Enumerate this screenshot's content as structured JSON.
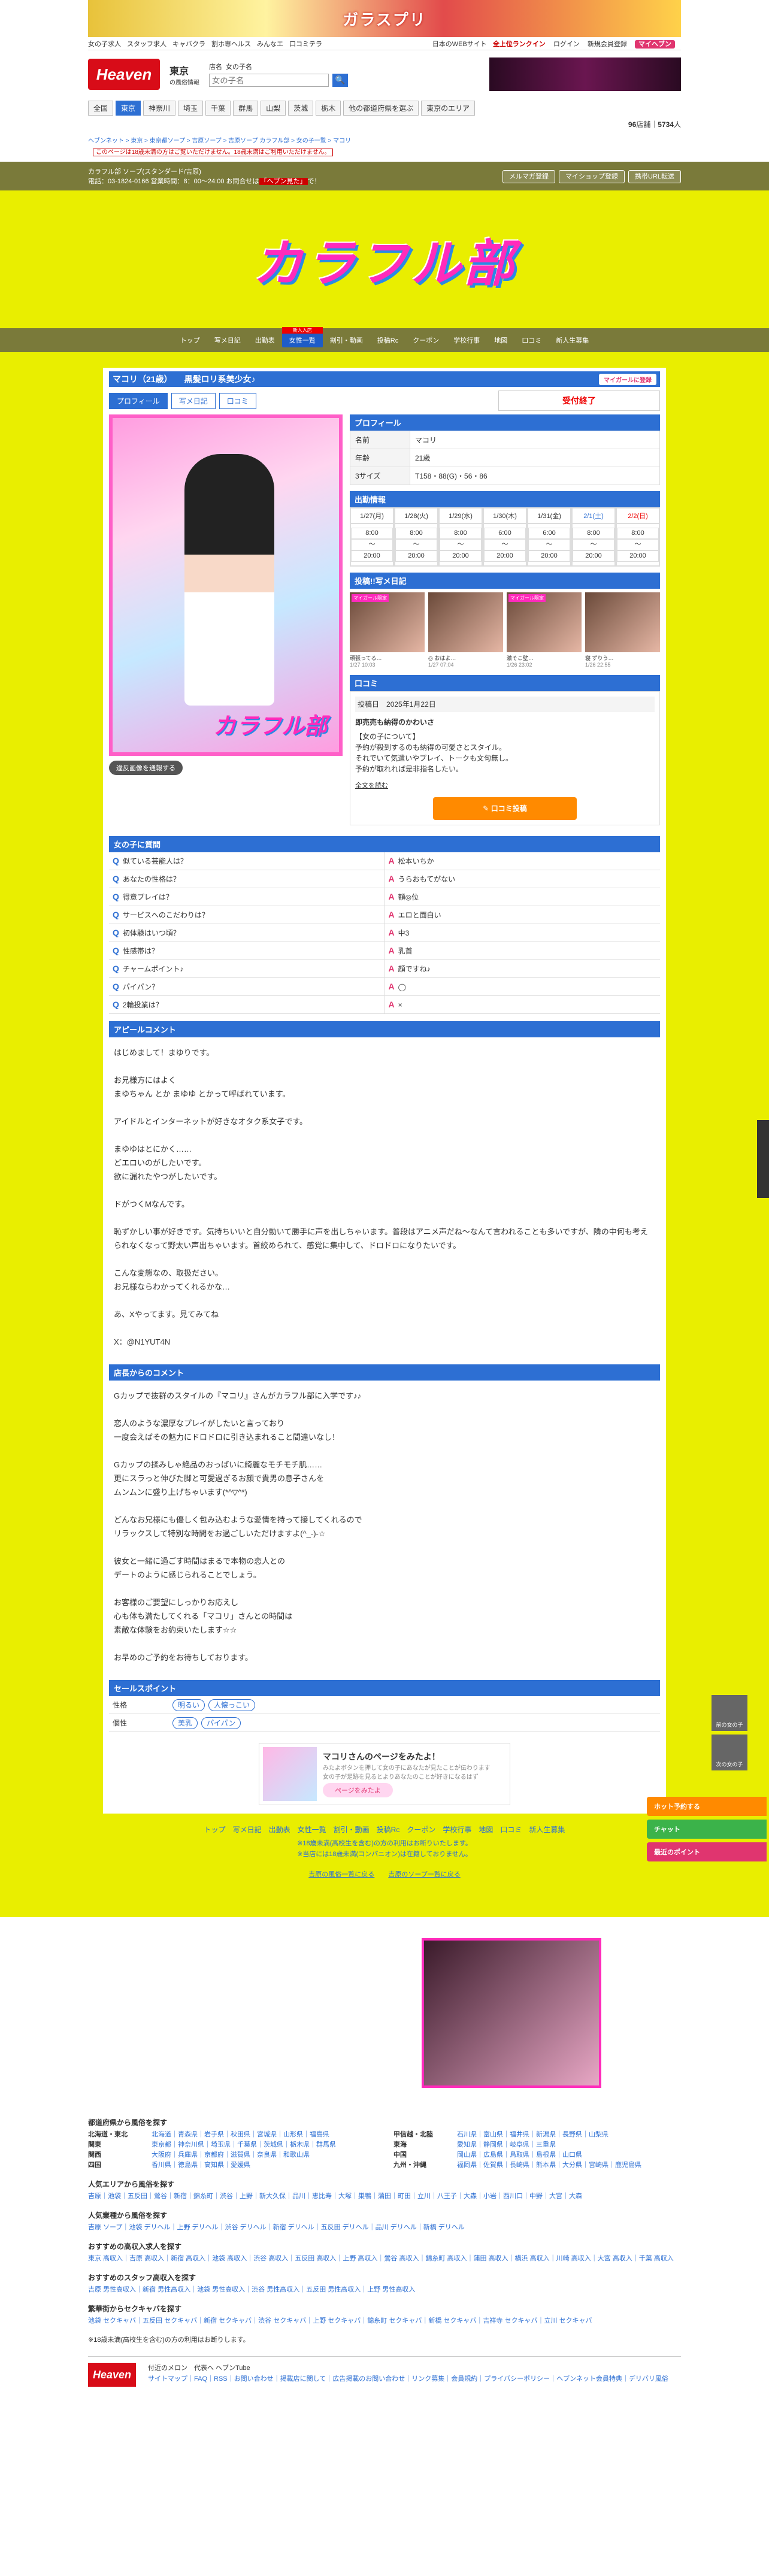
{
  "top_banner": {
    "text": "ガラスプリ"
  },
  "sitenav": {
    "left": [
      "女の子求人",
      "スタッフ求人",
      "キャバクラ",
      "割ホ専ヘルス",
      "みんなエ",
      "口コミテラ"
    ],
    "right": {
      "text": "日本のWEBサイト",
      "rank": "全上位ランクイン",
      "login": "ログイン",
      "register": "新規会員登録",
      "myheaven": "マイヘブン"
    }
  },
  "header": {
    "logo": "Heaven",
    "region": "東京",
    "region_sub": "の風俗情報",
    "search_label": "店名",
    "search_placeholder": "女の子名"
  },
  "areas": [
    "全国",
    "東京",
    "神奈川",
    "埼玉",
    "千葉",
    "群馬",
    "山梨",
    "茨城",
    "栃木",
    "他の都道府県を選ぶ",
    "東京のエリア"
  ],
  "counts": {
    "shops": "96",
    "shops_unit": "店舗",
    "girls": "5734",
    "girls_unit": "人"
  },
  "breadcrumb": "ヘブンネット > 東京 > 東京都ソープ > 吉原ソープ > 吉原ソープ カラフル部 > 女の子一覧 > マコリ",
  "notice": "このページは18歳未満の方はご覧いただけません。18歳未満はご利用いただけません。",
  "shopbar": {
    "name": "カラフル部 ソープ(スタンダード/吉原)",
    "tel": "電話：03-1824-0166 営業時間：8：00〜24:00 お問合せは",
    "tel_link": "「ヘブン見た」",
    "tel_end": "で！",
    "buttons": [
      "メルマガ登録",
      "マイショップ登録",
      "携帯URL転送"
    ]
  },
  "shop_logo": "カラフル部",
  "shop_menu": [
    "トップ",
    "写メ日記",
    "出勤表",
    "女性一覧",
    "割引・動画",
    "投稿Rc",
    "クーポン",
    "学校行事",
    "地図",
    "口コミ",
    "新人生募集"
  ],
  "shop_menu_badge": "新人入店",
  "girl": {
    "name": "マコリ（21歳）",
    "catch": "黒髪ロリ系美少女♪",
    "mypage": "マイガールに登録",
    "tabs": [
      "プロフィール",
      "写メ日記",
      "口コミ"
    ],
    "status": "受付終了",
    "photo_watermark": "カラフル部",
    "swap_button": "違反画像を通報する"
  },
  "profile": {
    "title": "プロフィール",
    "rows": [
      {
        "k": "名前",
        "v": "マコリ"
      },
      {
        "k": "年齢",
        "v": "21歳"
      },
      {
        "k": "3サイズ",
        "v": "T158・88(G)・56・86"
      }
    ]
  },
  "schedule": {
    "title": "出勤情報",
    "days": [
      {
        "d": "1/27(月)",
        "s": "8:00",
        "e": "20:00",
        "c": ""
      },
      {
        "d": "1/28(火)",
        "s": "8:00",
        "e": "20:00",
        "c": ""
      },
      {
        "d": "1/29(水)",
        "s": "8:00",
        "e": "20:00",
        "c": ""
      },
      {
        "d": "1/30(木)",
        "s": "6:00",
        "e": "20:00",
        "c": ""
      },
      {
        "d": "1/31(金)",
        "s": "6:00",
        "e": "20:00",
        "c": ""
      },
      {
        "d": "2/1(土)",
        "s": "8:00",
        "e": "20:00",
        "c": "blue"
      },
      {
        "d": "2/2(日)",
        "s": "8:00",
        "e": "20:00",
        "c": "red"
      }
    ]
  },
  "diary": {
    "title": "投稿!!写メ日記",
    "items": [
      {
        "tag": "マイガール限定",
        "cap": "頑張ってる…",
        "date": "1/27 10:03"
      },
      {
        "tag": "",
        "cap": "◎ おはよ…",
        "date": "1/27 07:04"
      },
      {
        "tag": "マイガール限定",
        "cap": "激そこ壁…",
        "date": "1/26 23:02"
      },
      {
        "tag": "",
        "cap": "寝 ずりう…",
        "date": "1/26 22:55"
      }
    ]
  },
  "review": {
    "title": "口コミ",
    "date_label": "投稿日",
    "date": "2025年1月22日",
    "heading": "即売売も納得のかわいさ",
    "text": "【女の子について】\n予約が殺到するのも納得の可愛さとスタイル。\nそれでいて気遣いやプレイ、トークも文句無し。\n予約が取れれば是非指名したい。",
    "more": "全文を読む",
    "post": "口コミ投稿"
  },
  "qa": {
    "title": "女の子に質問",
    "rows": [
      {
        "q": "似ている芸能人は？",
        "a": "松本いちか"
      },
      {
        "q": "あなたの性格は？",
        "a": "うらおもてがない"
      },
      {
        "q": "得意プレイは？",
        "a": "額◎位"
      },
      {
        "q": "サービスへのこだわりは？",
        "a": "エロと面白い"
      },
      {
        "q": "初体験はいつ頃？",
        "a": "中3"
      },
      {
        "q": "性感帯は？",
        "a": "乳首"
      },
      {
        "q": "チャームポイント♪",
        "a": "顔ですね♪"
      },
      {
        "q": "パイパン？",
        "a": "◯"
      },
      {
        "q": "2輪投業は？",
        "a": "×"
      }
    ]
  },
  "appeal": {
    "title": "アピールコメント",
    "text": "はじめまして！まゆりです。\n\nお兄様方にはよく\nまゆちゃん とか まゆゆ とかって呼ばれています。\n\nアイドルとインターネットが好きなオタク系女子です。\n\nまゆゆはとにかく……\nどエロいのがしたいです。\n欲に漏れたやつがしたいです。\n\nドがつくMなんです。\n\n恥ずかしい事が好きです。気持ちいいと自分動いて勝手に声を出しちゃいます。普段はアニメ声だね〜なんて言われることも多いですが、隣の中何も考えられなくなって野太い声出ちゃいます。首絞められて、感覚に集中して、ドロドロになりたいです。\n\nこんな変態なの、取扱ださい。\nお兄様ならわかってくれるかな…\n\nあ、Xやってます。見てみてね\n\nX：@N1YUT4N"
  },
  "staff": {
    "title": "店長からのコメント",
    "text": "Gカップで抜群のスタイルの『マコリ』さんがカラフル部に入学です♪♪\n\n恋人のような濃厚なプレイがしたいと言っており\n一度会えばその魅力にドロドロに引き込まれること間違いなし！\n\nGカップの揉みしゃ絶品のおっぱいに綺麗なモチモチ肌……\n更にスラっと伸びた脚と可愛過ぎるお顔で貴男の息子さんを\nムンムンに盛り上げちゃいます(*^▽^*)\n\nどんなお兄様にも優しく包み込むような愛情を持って接してくれるので\nリラックスして特別な時間をお過ごしいただけますよ(^_-)-☆\n\n彼女と一緒に過ごす時間はまるで本物の恋人との\nデートのように感じられることでしょう。\n\nお客様のご要望にしっかりお応えし\n心も体も満たしてくれる「マコリ」さんとの時間は\n素敵な体験をお約束いたします☆☆\n\nお早めのご予約をお待ちしております。"
  },
  "points": {
    "title": "セールスポイント",
    "rows": [
      {
        "k": "性格",
        "tags": [
          "明るい",
          "人懐っこい"
        ]
      },
      {
        "k": "個性",
        "tags": [
          "美乳",
          "パイパン"
        ]
      }
    ]
  },
  "mypage_banner": {
    "title": "マコリさんのページをみたよ！",
    "text": "みたよボタンを押して女の子にあなたが見たことが伝わります\n女の子が足跡を見るとよりあなたのことが好きになるはず",
    "go": "ページをみたよ"
  },
  "footer_menu": [
    "トップ",
    "写メ日記",
    "出勤表",
    "女性一覧",
    "割引・動画",
    "投稿Rc",
    "クーポン",
    "学校行事",
    "地図",
    "口コミ",
    "新人生募集"
  ],
  "footer_notes": [
    "※18歳未満(高校生を含む)の方の利用はお断りいたします。",
    "※当店には18歳未満(コンパニオン)は在籍しておりません。"
  ],
  "footer_links": [
    "吉原の風俗一覧に戻る",
    "吉原のソープ一覧に戻る"
  ],
  "regions": {
    "title": "都道府県から風俗を探す",
    "left": [
      {
        "k": "北海道・東北",
        "v": "北海道｜青森県｜岩手県｜秋田県｜宮城県｜山形県｜福島県"
      },
      {
        "k": "関東",
        "v": "東京都｜神奈川県｜埼玉県｜千葉県｜茨城県｜栃木県｜群馬県"
      },
      {
        "k": "関西",
        "v": "大阪府｜兵庫県｜京都府｜滋賀県｜奈良県｜和歌山県"
      },
      {
        "k": "四国",
        "v": "香川県｜徳島県｜高知県｜愛媛県"
      }
    ],
    "right": [
      {
        "k": "甲信越・北陸",
        "v": "石川県｜富山県｜福井県｜新潟県｜長野県｜山梨県"
      },
      {
        "k": "東海",
        "v": "愛知県｜静岡県｜岐阜県｜三重県"
      },
      {
        "k": "中国",
        "v": "岡山県｜広島県｜鳥取県｜島根県｜山口県"
      },
      {
        "k": "九州・沖縄",
        "v": "福岡県｜佐賀県｜長崎県｜熊本県｜大分県｜宮崎県｜鹿児島県"
      }
    ]
  },
  "popular_area": {
    "title": "人気エリアから風俗を探す",
    "v": "吉原｜池袋｜五反田｜鶯谷｜新宿｜錦糸町｜渋谷｜上野｜新大久保｜品川｜恵比寿｜大塚｜巣鴨｜蒲田｜町田｜立川｜八王子｜大森｜小岩｜西川口｜中野｜大宮｜大森"
  },
  "popular_type": {
    "title": "人気業種から風俗を探す",
    "v": "吉原 ソープ｜池袋 デリヘル｜上野 デリヘル｜渋谷 デリヘル｜新宿 デリヘル｜五反田 デリヘル｜品川 デリヘル｜新橋 デリヘル"
  },
  "recommend_job": {
    "title": "おすすめの高収入求人を探す",
    "v": "東京 高収入｜吉原 高収入｜新宿 高収入｜池袋 高収入｜渋谷 高収入｜五反田 高収入｜上野 高収入｜鶯谷 高収入｜錦糸町 高収入｜蒲田 高収入｜横浜 高収入｜川崎 高収入｜大宮 高収入｜千葉 高収入"
  },
  "recommend_staff": {
    "title": "おすすめのスタッフ高収入を探す",
    "v": "吉原 男性高収入｜新宿 男性高収入｜池袋 男性高収入｜渋谷 男性高収入｜五反田 男性高収入｜上野 男性高収入"
  },
  "sekukyaba": {
    "title": "繁華街からセクキャバを探す",
    "v": "池袋 セクキャバ｜五反田 セクキャバ｜新宿 セクキャバ｜渋谷 セクキャバ｜上野 セクキャバ｜錦糸町 セクキャバ｜新橋 セクキャバ｜吉祥寺 セクキャバ｜立川 セクキャバ"
  },
  "age_note": "※18歳未満(高校生を含む)の方の利用はお断りします。",
  "footer": {
    "logo": "Heaven",
    "l1": "付近のメロン　代表へ ヘブンTube",
    "l2": "サイトマップ｜FAQ｜RSS｜お問い合わせ｜掲載店に関して｜広告掲載のお問い合わせ｜リンク募集｜会員規約｜プライバシーポリシー｜ヘブンネット会員特典｜デリバリ風俗"
  },
  "floats": [
    "ホット予約する",
    "チャット",
    "最近のポイント"
  ],
  "pager": [
    "前の女の子",
    "次の女の子"
  ]
}
